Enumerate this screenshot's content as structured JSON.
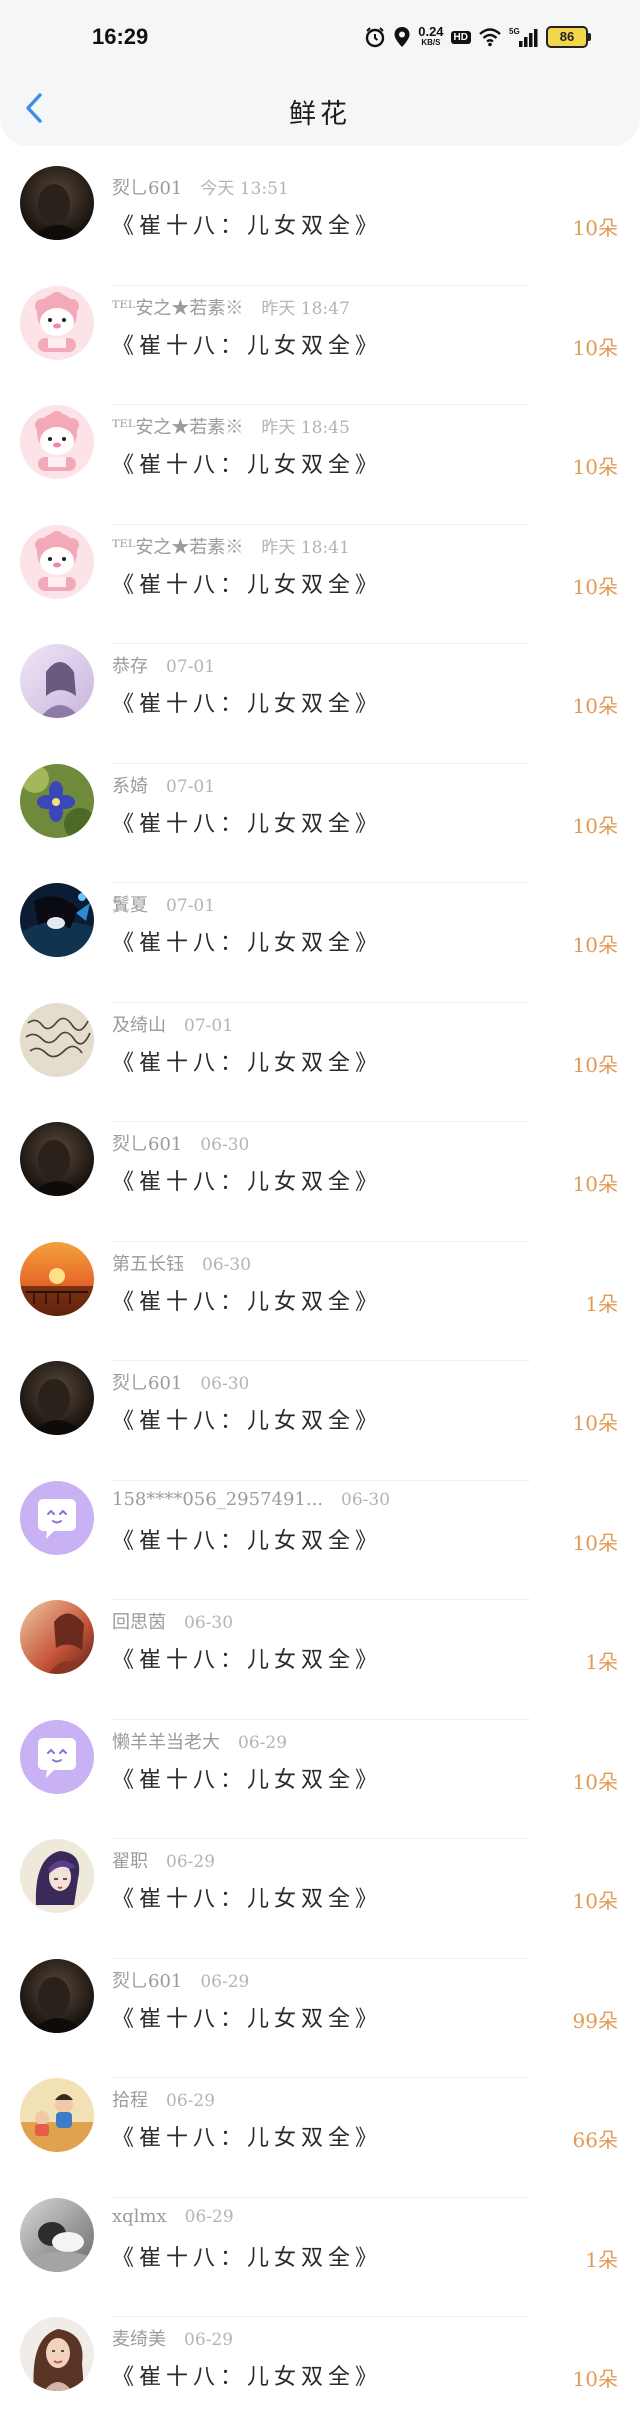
{
  "status_bar": {
    "time": "16:29",
    "net_speed": "0.24",
    "net_unit": "KB/S",
    "hd": "HD",
    "signal": "5G",
    "battery": "86",
    "icons": [
      "alarm-icon",
      "location-icon",
      "wifi-icon",
      "signal-icon",
      "battery-icon"
    ]
  },
  "header": {
    "back_icon": "chevron-left-icon",
    "title": "鲜花"
  },
  "colors": {
    "accent_blue": "#3a8ee6",
    "amount_orange": "#e19a55"
  },
  "records": [
    {
      "name": "烮乚601",
      "date": "今天 13:51",
      "gift": "《崔十八：儿女双全》",
      "amount": "10朵",
      "avatar": "dark-portrait"
    },
    {
      "name": "ᵀᴱᴸ安之★若素※",
      "date": "昨天 18:47",
      "gift": "《崔十八：儿女双全》",
      "amount": "10朵",
      "avatar": "pink-sheep"
    },
    {
      "name": "ᵀᴱᴸ安之★若素※",
      "date": "昨天 18:45",
      "gift": "《崔十八：儿女双全》",
      "amount": "10朵",
      "avatar": "pink-sheep"
    },
    {
      "name": "ᵀᴱᴸ安之★若素※",
      "date": "昨天 18:41",
      "gift": "《崔十八：儿女双全》",
      "amount": "10朵",
      "avatar": "pink-sheep"
    },
    {
      "name": "恭存",
      "date": "07-01",
      "gift": "《崔十八：儿女双全》",
      "amount": "10朵",
      "avatar": "purple-girl"
    },
    {
      "name": "系婍",
      "date": "07-01",
      "gift": "《崔十八：儿女双全》",
      "amount": "10朵",
      "avatar": "blue-flower"
    },
    {
      "name": "鬒夏",
      "date": "07-01",
      "gift": "《崔十八：儿女双全》",
      "amount": "10朵",
      "avatar": "anime-dark"
    },
    {
      "name": "及绮山",
      "date": "07-01",
      "gift": "《崔十八：儿女双全》",
      "amount": "10朵",
      "avatar": "handwriting"
    },
    {
      "name": "烮乚601",
      "date": "06-30",
      "gift": "《崔十八：儿女双全》",
      "amount": "10朵",
      "avatar": "dark-portrait"
    },
    {
      "name": "第五长钰",
      "date": "06-30",
      "gift": "《崔十八：儿女双全》",
      "amount": "1朵",
      "avatar": "sunset"
    },
    {
      "name": "烮乚601",
      "date": "06-30",
      "gift": "《崔十八：儿女双全》",
      "amount": "10朵",
      "avatar": "dark-portrait"
    },
    {
      "name": "158****056_2957491...",
      "date": "06-30",
      "gift": "《崔十八：儿女双全》",
      "amount": "10朵",
      "avatar": "chat-bubble"
    },
    {
      "name": "回思茵",
      "date": "06-30",
      "gift": "《崔十八：儿女双全》",
      "amount": "1朵",
      "avatar": "warm-photo"
    },
    {
      "name": "懒羊羊当老大",
      "date": "06-29",
      "gift": "《崔十八：儿女双全》",
      "amount": "10朵",
      "avatar": "chat-bubble"
    },
    {
      "name": "翟职",
      "date": "06-29",
      "gift": "《崔十八：儿女双全》",
      "amount": "10朵",
      "avatar": "purple-hair"
    },
    {
      "name": "烮乚601",
      "date": "06-29",
      "gift": "《崔十八：儿女双全》",
      "amount": "99朵",
      "avatar": "dark-portrait"
    },
    {
      "name": "拾程",
      "date": "06-29",
      "gift": "《崔十八：儿女双全》",
      "amount": "66朵",
      "avatar": "kids-photo"
    },
    {
      "name": "xqlmx",
      "date": "06-29",
      "gift": "《崔十八：儿女双全》",
      "amount": "1朵",
      "avatar": "bw-photo"
    },
    {
      "name": "麦绮美",
      "date": "06-29",
      "gift": "《崔十八：儿女双全》",
      "amount": "10朵",
      "avatar": "woman-portrait"
    }
  ]
}
